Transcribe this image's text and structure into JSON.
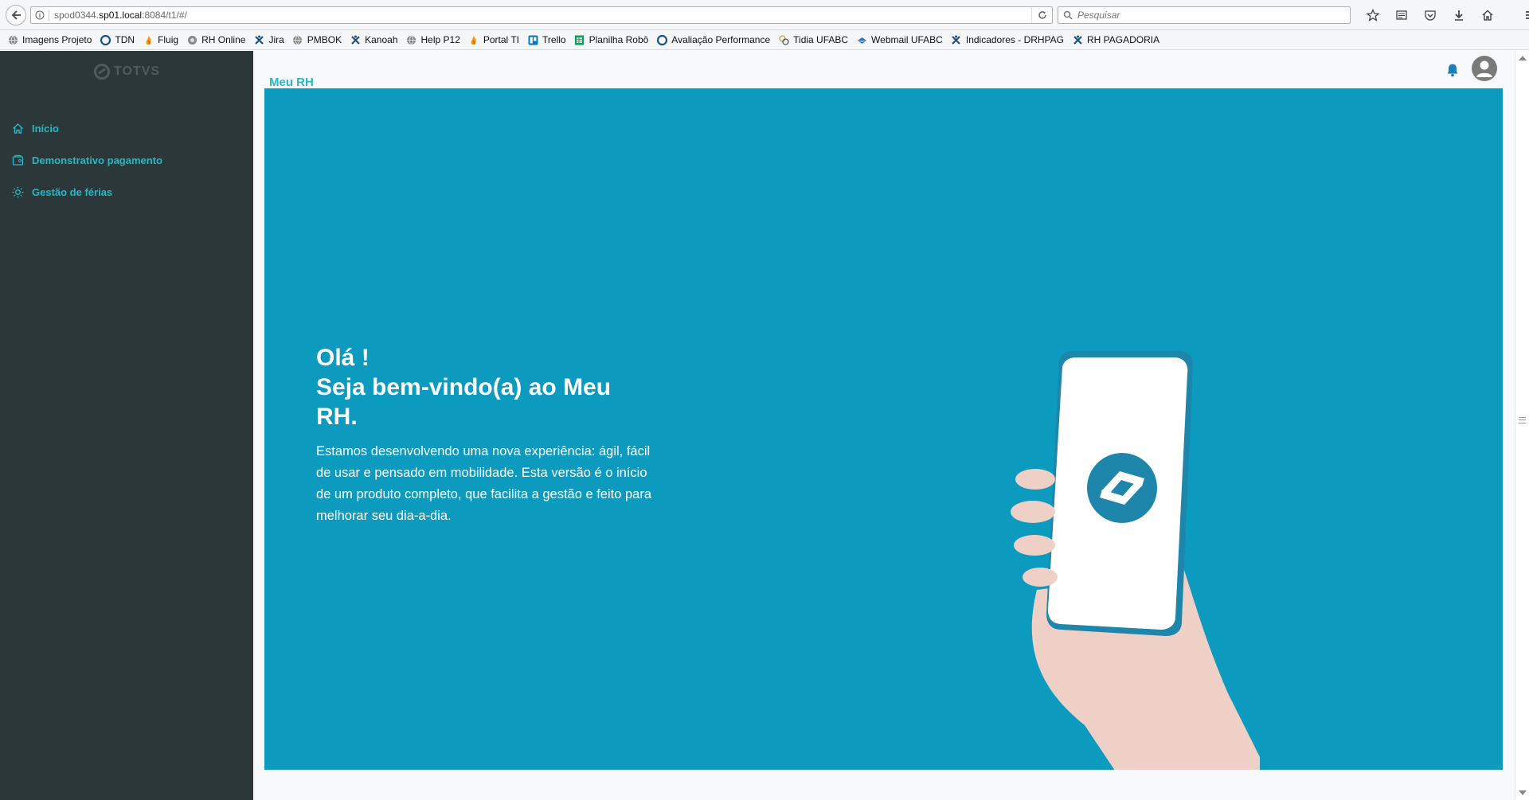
{
  "browser": {
    "url_prefix": "spod0344.",
    "url_host": "sp01.local",
    "url_suffix": ":8084/t1/#/",
    "search_placeholder": "Pesquisar",
    "bookmarks": [
      {
        "label": "Imagens Projeto",
        "icon": "globe-icon"
      },
      {
        "label": "TDN",
        "icon": "tdn-icon"
      },
      {
        "label": "Fluig",
        "icon": "fluig-icon"
      },
      {
        "label": "RH Online",
        "icon": "rh-online-icon"
      },
      {
        "label": "Jira",
        "icon": "jira-icon"
      },
      {
        "label": "PMBOK",
        "icon": "globe-icon"
      },
      {
        "label": "Kanoah",
        "icon": "kanoah-icon"
      },
      {
        "label": "Help P12",
        "icon": "globe-icon"
      },
      {
        "label": "Portal TI",
        "icon": "fluig-icon"
      },
      {
        "label": "Trello",
        "icon": "trello-icon"
      },
      {
        "label": "Planilha Robô",
        "icon": "sheets-icon"
      },
      {
        "label": "Avaliação Performance",
        "icon": "tdn-icon"
      },
      {
        "label": "Tidia UFABC",
        "icon": "tidia-icon"
      },
      {
        "label": "Webmail UFABC",
        "icon": "webmail-icon"
      },
      {
        "label": "Indicadores - DRHPAG",
        "icon": "jira-icon"
      },
      {
        "label": "RH PAGADORIA",
        "icon": "jira-icon"
      }
    ]
  },
  "sidebar": {
    "logo": "TOTVS",
    "items": [
      {
        "label": "Início",
        "icon": "home-icon"
      },
      {
        "label": "Demonstrativo pagamento",
        "icon": "payment-icon"
      },
      {
        "label": "Gestão de férias",
        "icon": "sun-icon"
      }
    ]
  },
  "header": {
    "title": "Meu RH"
  },
  "hero": {
    "title_line1": "Olá !",
    "title_line2": "Seja bem-vindo(a) ao Meu",
    "title_line3": "RH.",
    "body": "Estamos desenvolvendo uma nova experiência: ágil, fácil de usar e pensado em mobilidade. Esta versão é o início de um produto completo, que facilita a gestão e feito para melhorar seu dia-a-dia."
  },
  "colors": {
    "accent": "#29b6c5",
    "hero_bg": "#0c9abe",
    "sidebar_bg": "#2c3739"
  }
}
